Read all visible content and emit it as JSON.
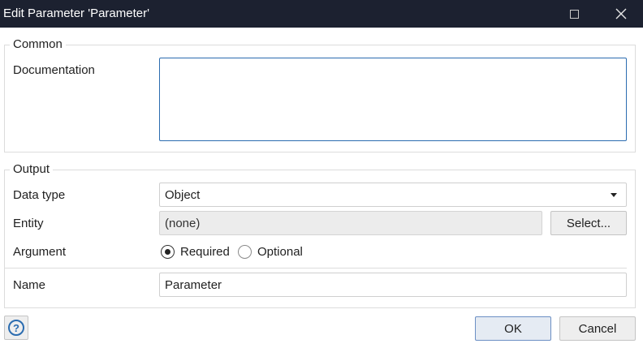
{
  "window": {
    "title": "Edit Parameter 'Parameter'",
    "maximize_icon": "maximize-icon",
    "close_icon": "close-icon"
  },
  "common": {
    "legend": "Common",
    "documentation_label": "Documentation",
    "documentation_value": ""
  },
  "output": {
    "legend": "Output",
    "data_type_label": "Data type",
    "data_type_value": "Object",
    "entity_label": "Entity",
    "entity_value": "(none)",
    "select_button": "Select...",
    "argument_label": "Argument",
    "argument_options": [
      {
        "label": "Required",
        "checked": true
      },
      {
        "label": "Optional",
        "checked": false
      }
    ],
    "name_label": "Name",
    "name_value": "Parameter"
  },
  "footer": {
    "help_icon": "help-icon",
    "help_glyph": "?",
    "ok_label": "OK",
    "cancel_label": "Cancel"
  },
  "colors": {
    "titlebar": "#1c2130",
    "focus_border": "#2b6cb0"
  }
}
